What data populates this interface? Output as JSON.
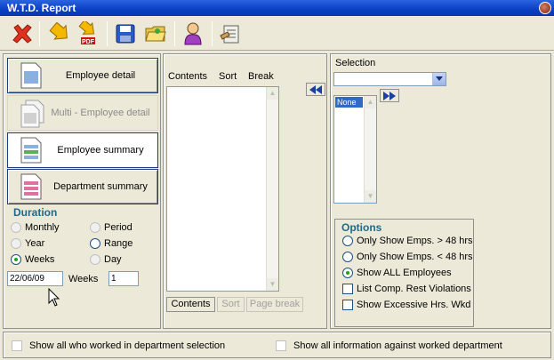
{
  "window": {
    "title": "W.T.D. Report"
  },
  "toolbar": {
    "icons": [
      "close-x-icon",
      "arrow-report-icon",
      "pdf-export-icon",
      "save-disk-icon",
      "open-folder-icon",
      "user-icon",
      "clipboard-settings-icon"
    ],
    "pdf_label": "PDF"
  },
  "reports": {
    "employee_detail": "Employee detail",
    "multi_employee_detail": "Multi - Employee detail",
    "employee_summary": "Employee summary",
    "department_summary": "Department summary"
  },
  "duration": {
    "header": "Duration",
    "monthly": "Monthly",
    "period": "Period",
    "year": "Year",
    "range": "Range",
    "weeks": "Weeks",
    "day": "Day",
    "date_value": "22/06/09",
    "weeks_label": "Weeks",
    "weeks_value": "1",
    "selected": "Weeks"
  },
  "contents_panel": {
    "col_contents": "Contents",
    "col_sort": "Sort",
    "col_break": "Break",
    "tab_contents": "Contents",
    "tab_sort": "Sort",
    "tab_page_break": "Page break"
  },
  "selection": {
    "label": "Selection",
    "dropdown_value": "",
    "list_items": [
      "None"
    ]
  },
  "options": {
    "header": "Options",
    "only_gt48": "Only Show Emps. > 48 hrs",
    "only_lt48": "Only Show Emps. < 48 hrs",
    "show_all": "Show ALL Employees",
    "list_comp": "List Comp. Rest Violations",
    "show_excessive": "Show Excessive Hrs. Wkd",
    "selected": "Show ALL Employees"
  },
  "footer": {
    "show_all_worked": "Show all who worked in department selection",
    "show_all_info": "Show all information against worked department"
  }
}
